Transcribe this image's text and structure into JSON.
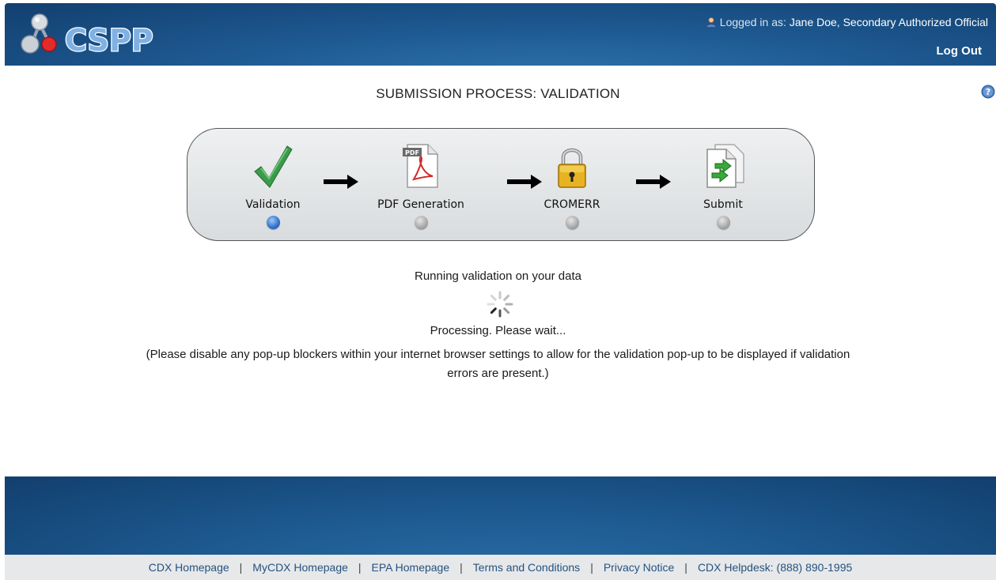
{
  "header": {
    "logo_text": "CSPP",
    "user_prefix": "Logged in as:",
    "user_name": "Jane Doe, Secondary Authorized Official",
    "logout_label": "Log Out",
    "user_icon": "user-icon"
  },
  "title": "SUBMISSION PROCESS: VALIDATION",
  "help_icon": "help-icon",
  "steps": [
    {
      "label": "Validation",
      "icon": "checkmark-icon",
      "active": true
    },
    {
      "label": "PDF Generation",
      "icon": "pdf-icon",
      "active": false
    },
    {
      "label": "CROMERR",
      "icon": "lock-icon",
      "active": false
    },
    {
      "label": "Submit",
      "icon": "submit-document-icon",
      "active": false
    }
  ],
  "status": {
    "running": "Running validation on your data",
    "processing": "Processing. Please wait...",
    "note_line1": "(Please disable any pop-up blockers within your internet browser settings to allow for the validation pop-up to be displayed if validation",
    "note_line2": "errors are present.)"
  },
  "footer": {
    "links": [
      "CDX Homepage",
      "MyCDX Homepage",
      "EPA Homepage",
      "Terms and Conditions",
      "Privacy Notice",
      "CDX Helpdesk: (888) 890-1995"
    ]
  },
  "colors": {
    "header_blue": "#1e5a92",
    "active_dot": "#2e6fc8",
    "link_blue": "#24527f"
  }
}
